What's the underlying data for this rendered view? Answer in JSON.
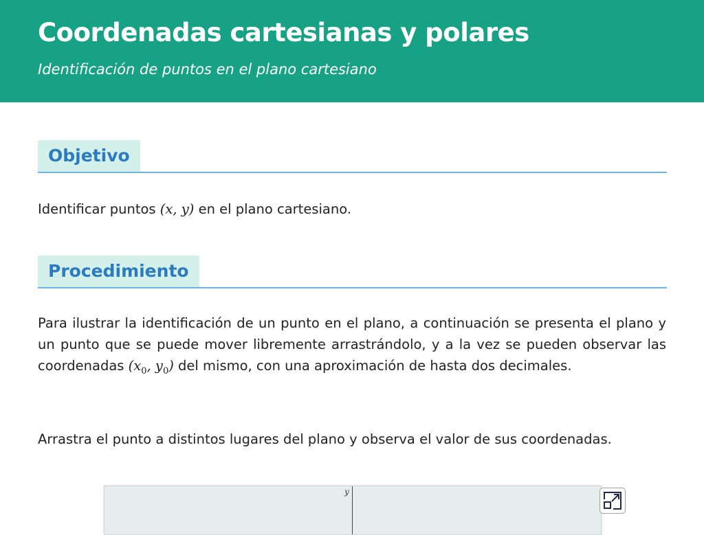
{
  "header": {
    "title": "Coordenadas cartesianas y polares",
    "subtitle": "Identificación de puntos en el plano cartesiano"
  },
  "sections": {
    "objetivo": {
      "heading": "Objetivo",
      "text_before": "Identificar puntos ",
      "math": "(x, y)",
      "text_after": " en el plano cartesiano."
    },
    "procedimiento": {
      "heading": "Procedimiento",
      "para1_before": "Para ilustrar la identificación de un punto en el plano, a continuación se presenta el plano y un punto que se puede mover libremente arrastrándolo, y a la vez se pueden observar las coordenadas ",
      "para1_math_open": "(",
      "para1_math_x": "x",
      "para1_math_x_sub": "0",
      "para1_math_sep": ", ",
      "para1_math_y": "y",
      "para1_math_y_sub": "0",
      "para1_math_close": ")",
      "para1_after": " del mismo, con una aproximación de hasta dos decimales.",
      "para2": "Arrastra el punto a distintos lugares del plano y observa el valor de sus coordenadas."
    }
  },
  "applet": {
    "y_axis_label": "y",
    "fullscreen_icon": "expand-icon"
  },
  "colors": {
    "header_bg": "#17a185",
    "heading_tab_bg": "#d3f0ea",
    "heading_text": "#2c7bbf",
    "rule": "#6fb2ea",
    "applet_bg": "#e6eeed"
  }
}
